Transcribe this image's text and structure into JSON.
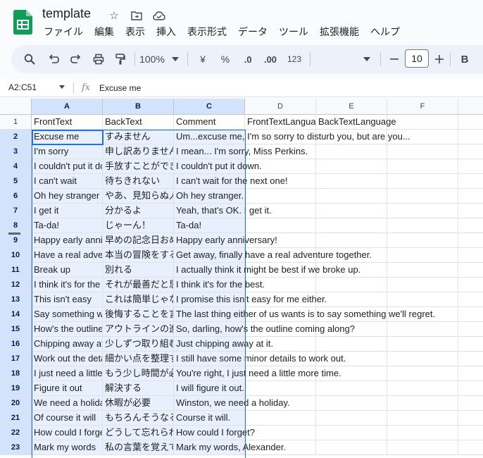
{
  "doc": {
    "title": "template"
  },
  "menu": [
    "ファイル",
    "編集",
    "表示",
    "挿入",
    "表示形式",
    "データ",
    "ツール",
    "拡張機能",
    "ヘルプ"
  ],
  "toolbar": {
    "zoom": "100%",
    "currency": "¥",
    "percent": "%",
    "decrease_decimal": ".0",
    "increase_decimal": ".00",
    "number_format": "123",
    "font_size": "10",
    "bold": "B"
  },
  "formula_bar": {
    "name_box": "A2:C51",
    "fx": "fx",
    "formula": "Excuse me"
  },
  "columns": [
    "A",
    "B",
    "C",
    "D",
    "E",
    "F"
  ],
  "rows": [
    {
      "num": "1",
      "a": "FrontText",
      "b": "BackText",
      "c": "Comment",
      "d": "FrontTextLanguage",
      "e": "BackTextLanguage"
    },
    {
      "num": "2",
      "a": "Excuse me",
      "b": "すみません",
      "c": "Um...excuse me, I'm so sorry to disturb you, but are you..."
    },
    {
      "num": "3",
      "a": "I'm sorry",
      "b": "申し訳ありません",
      "c": "I mean... I'm sorry, Miss Perkins."
    },
    {
      "num": "4",
      "a": "I couldn't put it down",
      "b": "手放すことができない",
      "c": "I couldn't put it down."
    },
    {
      "num": "5",
      "a": "I can't wait",
      "b": "待ちきれない",
      "c": "I can't wait for the next one!"
    },
    {
      "num": "6",
      "a": "Oh hey stranger",
      "b": "やあ、見知らぬ人",
      "c": "Oh hey stranger."
    },
    {
      "num": "7",
      "a": "I get it",
      "b": "分かるよ",
      "c": "Yeah, that's OK. I get it."
    },
    {
      "num": "8",
      "a": "Ta-da!",
      "b": "じゃーん！",
      "c": "Ta-da!"
    },
    {
      "num": "9",
      "a": "Happy early anniversary",
      "b": "早めの記念日おめでとう",
      "c": "Happy early anniversary!"
    },
    {
      "num": "10",
      "a": "Have a real adventure",
      "b": "本当の冒険をする",
      "c": "Get away, finally have a real adventure together."
    },
    {
      "num": "11",
      "a": "Break up",
      "b": "別れる",
      "c": "I actually think it might be best if we broke up."
    },
    {
      "num": "12",
      "a": "I think it's for the best",
      "b": "それが最善だと思う",
      "c": "I think it's for the best."
    },
    {
      "num": "13",
      "a": "This isn't easy",
      "b": "これは簡単じゃない",
      "c": "I promise this isn't easy for me either."
    },
    {
      "num": "14",
      "a": "Say something we'll regret",
      "b": "後悔することを言う",
      "c": "The last thing either of us wants is to say something we'll regret."
    },
    {
      "num": "15",
      "a": "How's the outline coming along",
      "b": "アウトラインの進み具合は",
      "c": "So, darling, how's the outline coming along?"
    },
    {
      "num": "16",
      "a": "Chipping away at it",
      "b": "少しずつ取り組む",
      "c": "Just chipping away at it."
    },
    {
      "num": "17",
      "a": "Work out the details",
      "b": "細かい点を整理する",
      "c": "I still have some minor details to work out."
    },
    {
      "num": "18",
      "a": "I just need a little more time",
      "b": "もう少し時間が必要",
      "c": "You're right, I just need a little more time."
    },
    {
      "num": "19",
      "a": "Figure it out",
      "b": "解決する",
      "c": "I will figure it out."
    },
    {
      "num": "20",
      "a": "We need a holiday",
      "b": "休暇が必要",
      "c": "Winston, we need a holiday."
    },
    {
      "num": "21",
      "a": "Of course it will",
      "b": "もちろんそうなる",
      "c": "Course it will."
    },
    {
      "num": "22",
      "a": "How could I forget",
      "b": "どうして忘れられる",
      "c": "How could I forget?"
    },
    {
      "num": "23",
      "a": "Mark my words",
      "b": "私の言葉を覚えておいて",
      "c": "Mark my words, Alexander."
    }
  ]
}
